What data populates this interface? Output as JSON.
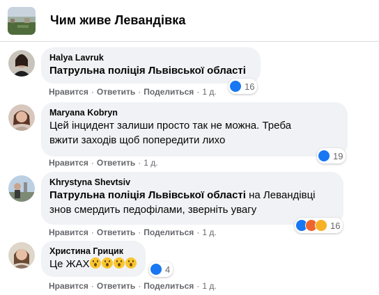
{
  "group": {
    "title": "Чим живе Левандівка"
  },
  "actions": {
    "like": "Нравится",
    "reply": "Ответить",
    "share": "Поделиться",
    "sep": "·"
  },
  "comments": [
    {
      "author": "Halya Lavruk",
      "mention": "Патрульна поліція Львівської області",
      "text": "",
      "time": "1 д.",
      "reactions": [
        "like"
      ],
      "count": "16"
    },
    {
      "author": "Maryana Kobryn",
      "mention": "",
      "text_line1": "Цей інцидент залиши просто так не можна. Треба",
      "text_line2": "вжити заходів щоб попередити лихо",
      "time": "1 д.",
      "reactions": [
        "like"
      ],
      "count": "19"
    },
    {
      "author": "Khrystyna Shevtsiv",
      "mention": "Патрульна поліція Львівської області",
      "text_after": " на Левандівці",
      "text_line2": "знов смердить педофілами, зверніть увагу",
      "time": "1 д.",
      "reactions": [
        "like",
        "angry",
        "haha"
      ],
      "count": "16"
    },
    {
      "author": "Христина Грицик",
      "text": "Це ЖАХ",
      "emoji_count": 4,
      "time": "1 д.",
      "reactions": [
        "like"
      ],
      "count": "4"
    }
  ],
  "colors": {
    "bubble": "#f0f2f5",
    "meta": "#65676b",
    "like": "#1877f2"
  }
}
